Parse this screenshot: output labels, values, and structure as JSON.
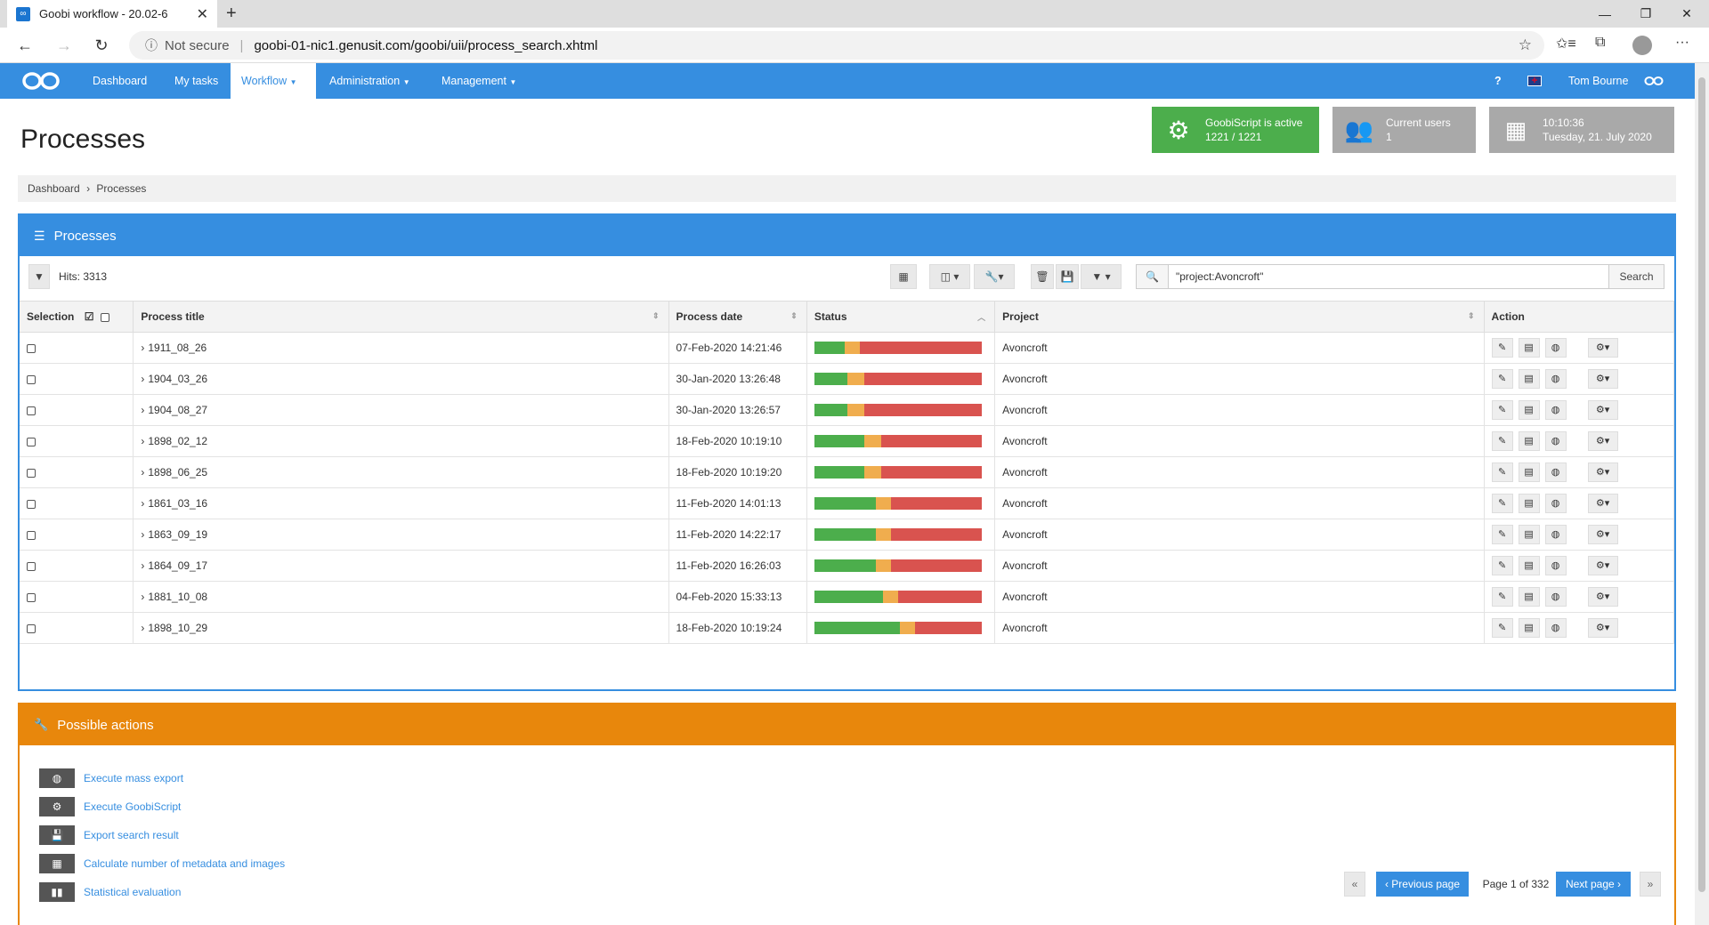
{
  "browser": {
    "tab_title": "Goobi workflow - 20.02-6",
    "security": "Not secure",
    "url": "goobi-01-nic1.genusit.com/goobi/uii/process_search.xhtml"
  },
  "nav": {
    "items": [
      "Dashboard",
      "My tasks",
      "Workflow",
      "Administration",
      "Management"
    ],
    "help": "?",
    "user": "Tom Bourne"
  },
  "page_title": "Processes",
  "infoboxes": {
    "goobiscript_title": "GoobiScript is active",
    "goobiscript_count": "1221 / 1221",
    "users_title": "Current users",
    "users_count": "1",
    "time": "10:10:36",
    "date": "Tuesday, 21. July 2020"
  },
  "breadcrumb": {
    "home": "Dashboard",
    "sep": "›",
    "current": "Processes"
  },
  "box_title": "Processes",
  "hits": "Hits: 3313",
  "search": {
    "value": "\"project:Avoncroft\"",
    "button": "Search"
  },
  "columns": {
    "selection": "Selection",
    "title": "Process title",
    "date": "Process date",
    "status": "Status",
    "project": "Project",
    "action": "Action"
  },
  "rows": [
    {
      "title": "1911_08_26",
      "date": "07-Feb-2020 14:21:46",
      "project": "Avoncroft",
      "status": [
        0.18,
        0.09,
        0.73
      ]
    },
    {
      "title": "1904_03_26",
      "date": "30-Jan-2020 13:26:48",
      "project": "Avoncroft",
      "status": [
        0.2,
        0.1,
        0.7
      ]
    },
    {
      "title": "1904_08_27",
      "date": "30-Jan-2020 13:26:57",
      "project": "Avoncroft",
      "status": [
        0.2,
        0.1,
        0.7
      ]
    },
    {
      "title": "1898_02_12",
      "date": "18-Feb-2020 10:19:10",
      "project": "Avoncroft",
      "status": [
        0.3,
        0.1,
        0.6
      ]
    },
    {
      "title": "1898_06_25",
      "date": "18-Feb-2020 10:19:20",
      "project": "Avoncroft",
      "status": [
        0.3,
        0.1,
        0.6
      ]
    },
    {
      "title": "1861_03_16",
      "date": "11-Feb-2020 14:01:13",
      "project": "Avoncroft",
      "status": [
        0.37,
        0.09,
        0.54
      ]
    },
    {
      "title": "1863_09_19",
      "date": "11-Feb-2020 14:22:17",
      "project": "Avoncroft",
      "status": [
        0.37,
        0.09,
        0.54
      ]
    },
    {
      "title": "1864_09_17",
      "date": "11-Feb-2020 16:26:03",
      "project": "Avoncroft",
      "status": [
        0.37,
        0.09,
        0.54
      ]
    },
    {
      "title": "1881_10_08",
      "date": "04-Feb-2020 15:33:13",
      "project": "Avoncroft",
      "status": [
        0.41,
        0.09,
        0.5
      ]
    },
    {
      "title": "1898_10_29",
      "date": "18-Feb-2020 10:19:24",
      "project": "Avoncroft",
      "status": [
        0.51,
        0.09,
        0.4
      ]
    }
  ],
  "status_colors": {
    "done": "#4cae4c",
    "inwork": "#f0ad4e",
    "open": "#d9534f"
  },
  "pager": {
    "first": "«",
    "prev": "‹ Previous page",
    "info": "Page 1 of 332",
    "next": "Next page ›",
    "last": "»"
  },
  "actions_title": "Possible actions",
  "actions": [
    {
      "label": "Execute mass export",
      "icon": "globe-icon"
    },
    {
      "label": "Execute GoobiScript",
      "icon": "gears-icon"
    },
    {
      "label": "Export search result",
      "icon": "save-icon"
    },
    {
      "label": "Calculate number of metadata and images",
      "icon": "table-icon"
    },
    {
      "label": "Statistical evaluation",
      "icon": "bar-chart-icon"
    }
  ],
  "colors": {
    "primary": "#368ee0",
    "orange": "#e8870c",
    "green": "#4cae4c"
  }
}
